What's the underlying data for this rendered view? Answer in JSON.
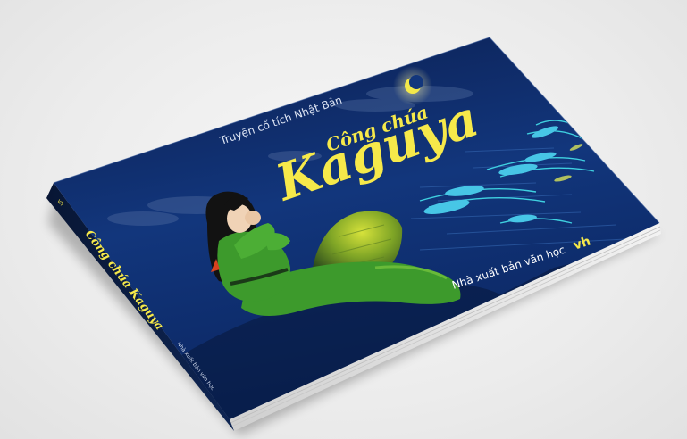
{
  "book": {
    "series": "Truyện cổ tích Nhật Bản",
    "title_small": "Công chúa",
    "title_large": "Kaguya",
    "publisher": "Nhà xuất bản văn học",
    "publisher_logo": "vh",
    "spine_title": "Công chúa Kaguya",
    "spine_publisher": "Nhà xuất bản văn học"
  },
  "colors": {
    "background": "#ececec",
    "cover_night_blue": "#0d2a68",
    "moon_yellow": "#f3e84a",
    "title_yellow": "#f6e94a",
    "dress_green": "#3d9a2c",
    "reeds_cyan": "#3fd0e0",
    "spine_dark": "#0a1a3c"
  }
}
